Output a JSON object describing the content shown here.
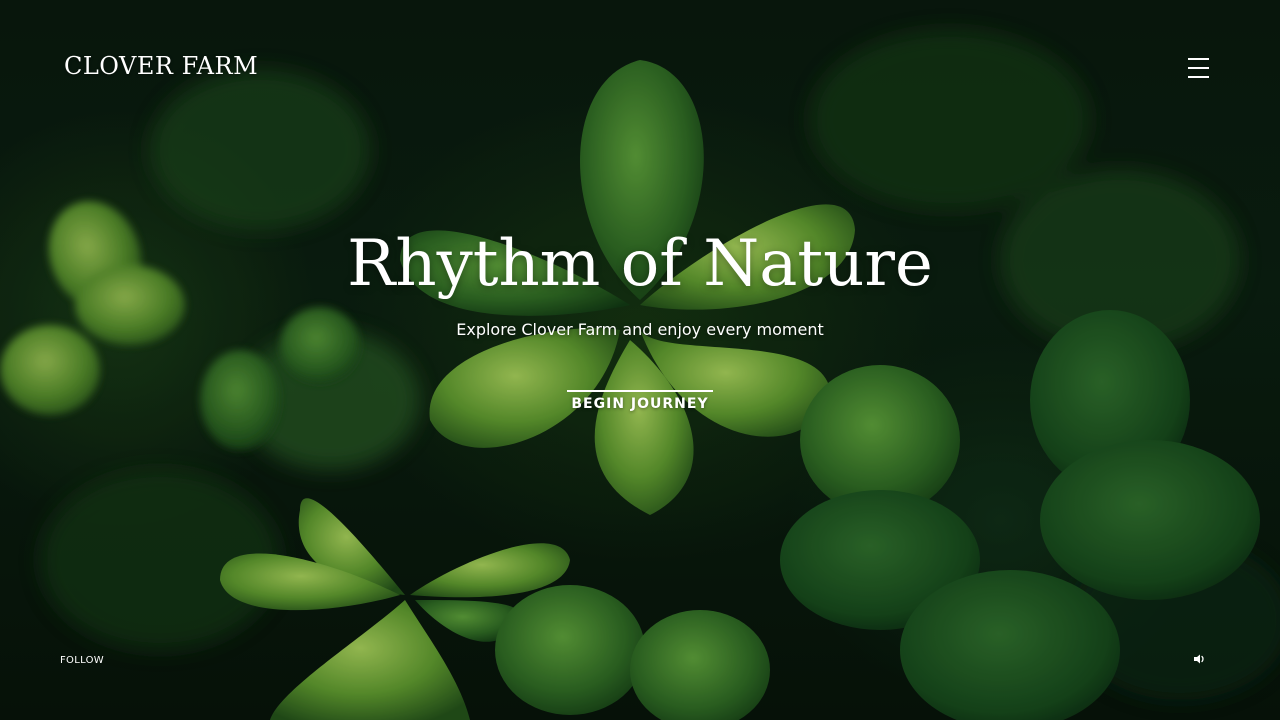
{
  "header": {
    "brand": "CLOVER FARM",
    "menu_icon": "hamburger-menu-icon"
  },
  "hero": {
    "title": "Rhythm of Nature",
    "subtitle": "Explore Clover Farm and enjoy every moment",
    "cta_label": "BEGIN JOURNEY"
  },
  "footer": {
    "follow_label": "FOLLOW",
    "sound_icon": "speaker-icon"
  },
  "colors": {
    "text": "#ffffff",
    "background_dark": "#0b1f10",
    "leaf_green": "#6aa63a"
  }
}
